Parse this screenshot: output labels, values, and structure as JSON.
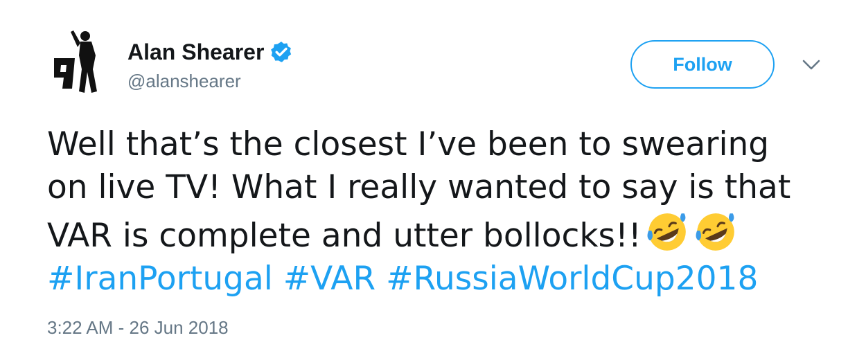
{
  "user": {
    "display_name": "Alan Shearer",
    "handle": "@alanshearer",
    "verified": true
  },
  "actions": {
    "follow_label": "Follow"
  },
  "tweet": {
    "line1": "Well that’s the closest I’ve been to swearing",
    "line2": "on live TV! What I really wanted to say is that",
    "line3": "VAR is complete and utter bollocks!!",
    "hashtags": [
      "#IranPortugal",
      "#VAR",
      "#RussiaWorldCup2018"
    ],
    "timestamp": "3:22 AM - 26 Jun 2018"
  },
  "icons": {
    "verified": "verified-badge-icon",
    "more": "chevron-down-icon",
    "emoji": "rolling-on-floor-laughing-emoji"
  },
  "colors": {
    "accent": "#1da1f2",
    "text": "#14171a",
    "secondary": "#657786"
  }
}
